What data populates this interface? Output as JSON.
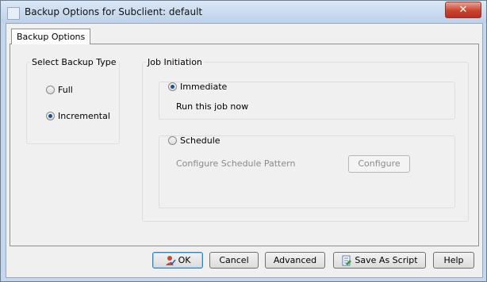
{
  "window": {
    "title": "Backup Options for Subclient: default",
    "close_glyph": "✕"
  },
  "tabs": [
    {
      "label": "Backup Options"
    }
  ],
  "backup_type": {
    "legend": "Select Backup Type",
    "options": [
      {
        "label": "Full",
        "selected": false
      },
      {
        "label": "Incremental",
        "selected": true
      }
    ]
  },
  "job_initiation": {
    "legend": "Job Initiation",
    "immediate": {
      "label": "Immediate",
      "selected": true,
      "description": "Run this job now"
    },
    "schedule": {
      "label": "Schedule",
      "selected": false,
      "pattern_label": "Configure Schedule Pattern",
      "configure_label": "Configure"
    }
  },
  "buttons": {
    "ok": "OK",
    "cancel": "Cancel",
    "advanced": "Advanced",
    "save_as_script": "Save As Script",
    "help": "Help"
  },
  "icons": {
    "app": "window-icon",
    "ok": "user-check-icon",
    "script": "script-icon"
  }
}
